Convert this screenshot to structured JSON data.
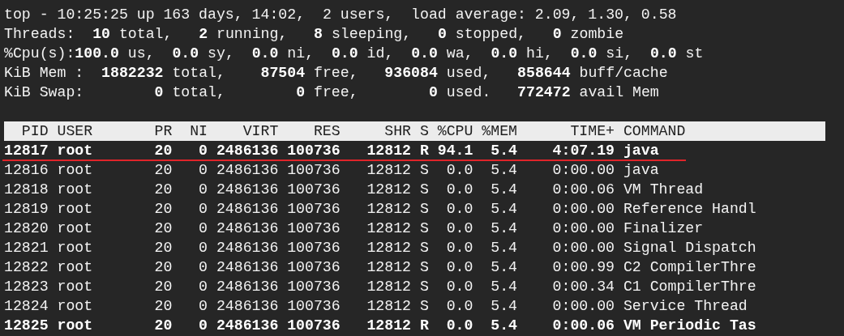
{
  "summary": [
    "top - 10:25:25 up 163 days, 14:02,  2 users,  load average: 2.09, 1.30, 0.58",
    "Threads:  **10** total,   **2** running,   **8** sleeping,   **0** stopped,   **0** zombie",
    "%Cpu(s):**100.0** us,  **0.0** sy,  **0.0** ni,  **0.0** id,  **0.0** wa,  **0.0** hi,  **0.0** si,  **0.0** st",
    "KiB Mem :  **1882232** total,    **87504** free,   **936084** used,   **858644** buff/cache",
    "KiB Swap:        **0** total,        **0** free,        **0** used.   **772472** avail Mem"
  ],
  "table": {
    "columns": [
      "PID",
      "USER",
      "PR",
      "NI",
      "VIRT",
      "RES",
      "SHR",
      "S",
      "%CPU",
      "%MEM",
      "TIME+",
      "COMMAND"
    ],
    "rows": [
      {
        "cells": [
          "12817",
          "root",
          "20",
          "0",
          "2486136",
          "100736",
          "12812",
          "R",
          "94.1",
          "5.4",
          "4:07.19",
          "java"
        ],
        "highlighted": true,
        "underlined": true
      },
      {
        "cells": [
          "12816",
          "root",
          "20",
          "0",
          "2486136",
          "100736",
          "12812",
          "S",
          "0.0",
          "5.4",
          "0:00.00",
          "java"
        ],
        "highlighted": false,
        "underlined": false
      },
      {
        "cells": [
          "12818",
          "root",
          "20",
          "0",
          "2486136",
          "100736",
          "12812",
          "S",
          "0.0",
          "5.4",
          "0:00.06",
          "VM Thread"
        ],
        "highlighted": false,
        "underlined": false
      },
      {
        "cells": [
          "12819",
          "root",
          "20",
          "0",
          "2486136",
          "100736",
          "12812",
          "S",
          "0.0",
          "5.4",
          "0:00.00",
          "Reference Handl"
        ],
        "highlighted": false,
        "underlined": false
      },
      {
        "cells": [
          "12820",
          "root",
          "20",
          "0",
          "2486136",
          "100736",
          "12812",
          "S",
          "0.0",
          "5.4",
          "0:00.00",
          "Finalizer"
        ],
        "highlighted": false,
        "underlined": false
      },
      {
        "cells": [
          "12821",
          "root",
          "20",
          "0",
          "2486136",
          "100736",
          "12812",
          "S",
          "0.0",
          "5.4",
          "0:00.00",
          "Signal Dispatch"
        ],
        "highlighted": false,
        "underlined": false
      },
      {
        "cells": [
          "12822",
          "root",
          "20",
          "0",
          "2486136",
          "100736",
          "12812",
          "S",
          "0.0",
          "5.4",
          "0:00.99",
          "C2 CompilerThre"
        ],
        "highlighted": false,
        "underlined": false
      },
      {
        "cells": [
          "12823",
          "root",
          "20",
          "0",
          "2486136",
          "100736",
          "12812",
          "S",
          "0.0",
          "5.4",
          "0:00.34",
          "C1 CompilerThre"
        ],
        "highlighted": false,
        "underlined": false
      },
      {
        "cells": [
          "12824",
          "root",
          "20",
          "0",
          "2486136",
          "100736",
          "12812",
          "S",
          "0.0",
          "5.4",
          "0:00.00",
          "Service Thread"
        ],
        "highlighted": false,
        "underlined": false
      },
      {
        "cells": [
          "12825",
          "root",
          "20",
          "0",
          "2486136",
          "100736",
          "12812",
          "R",
          "0.0",
          "5.4",
          "0:00.06",
          "VM Periodic Tas"
        ],
        "highlighted": true,
        "underlined": false
      }
    ]
  }
}
